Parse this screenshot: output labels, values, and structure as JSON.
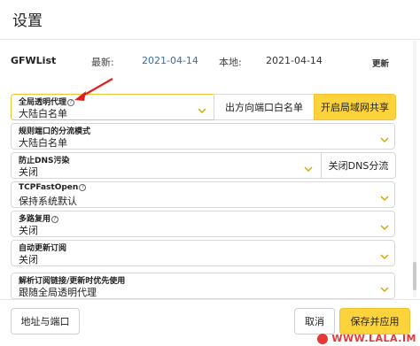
{
  "dialog": {
    "title": "设置"
  },
  "gfwlist": {
    "name": "GFWList",
    "latest_label": "最新:",
    "latest_date": "2021-04-14",
    "local_label": "本地:",
    "local_date": "2021-04-14",
    "update_label": "更新"
  },
  "fields": [
    {
      "label": "全局透明代理",
      "help": "?",
      "value": "大陆白名单",
      "buttons": [
        "出方向端口白名单",
        "开启局域网共享"
      ]
    },
    {
      "label": "规则端口的分流模式",
      "value": "大陆白名单"
    },
    {
      "label": "防止DNS污染",
      "value": "关闭",
      "buttons": [
        "关闭DNS分流"
      ]
    },
    {
      "label": "TCPFastOpen",
      "help": "?",
      "value": "保持系统默认"
    },
    {
      "label": "多路复用",
      "help": "?",
      "value": "关闭"
    },
    {
      "label": "自动更新订阅",
      "value": "关闭"
    },
    {
      "label": "解析订阅链接/更新时优先使用",
      "value": "跟随全局透明代理"
    }
  ],
  "footer": {
    "address_port": "地址与端口",
    "cancel": "取消",
    "save_apply": "保存并应用"
  },
  "watermark": {
    "text": "WWW.LALA.IM"
  },
  "colors": {
    "accent": "#fcd33a",
    "link": "#3a6ea5",
    "arrow": "#e02020"
  }
}
